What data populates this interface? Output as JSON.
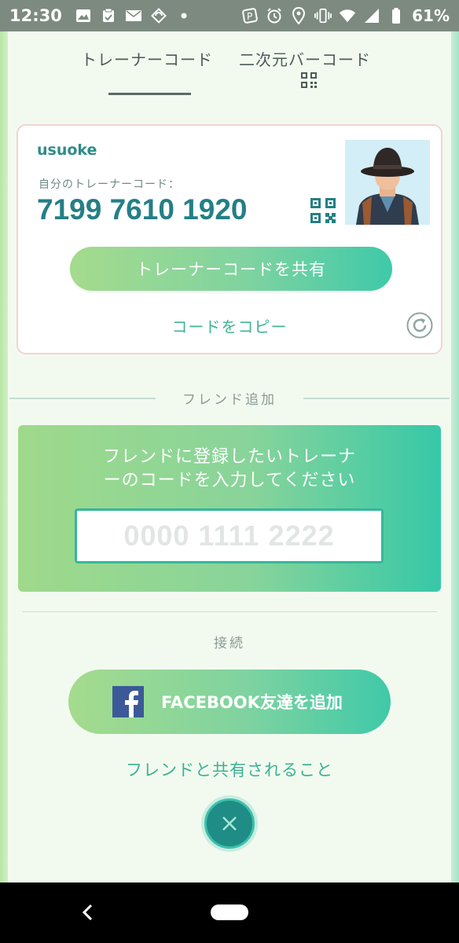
{
  "status_bar": {
    "time": "12:30",
    "battery": "61%",
    "left_icons": [
      "image-icon",
      "clipboard-icon",
      "mail-icon",
      "sync-icon",
      "dot-icon"
    ],
    "right_icons": [
      "nfc-icon",
      "alarm-icon",
      "location-icon",
      "vibrate-icon",
      "wifi-icon",
      "signal-icon",
      "battery-icon"
    ]
  },
  "tabs": [
    {
      "label": "トレーナーコード",
      "active": true
    },
    {
      "label": "二次元バーコード",
      "active": false,
      "icon": "qr-code-icon"
    }
  ],
  "trainer_card": {
    "username": "usuoke",
    "code_label": "自分のトレーナーコード：",
    "code": "7199 7610 1920",
    "share_button": "トレーナーコードを共有",
    "copy_link": "コードをコピー"
  },
  "add_friend": {
    "section_title": "フレンド追加",
    "instruction_line1": "フレンドに登録したいトレーナ",
    "instruction_line2": "ーのコードを入力してください",
    "input_placeholder": "0000 1111 2222",
    "input_value": ""
  },
  "connect": {
    "section_title": "接続",
    "facebook_button": "FACEBOOK友達を追加",
    "shared_info_link": "フレンドと共有されること"
  },
  "colors": {
    "accent_teal": "#247f86",
    "link_green": "#3fb593",
    "facebook_blue": "#3b5998"
  }
}
